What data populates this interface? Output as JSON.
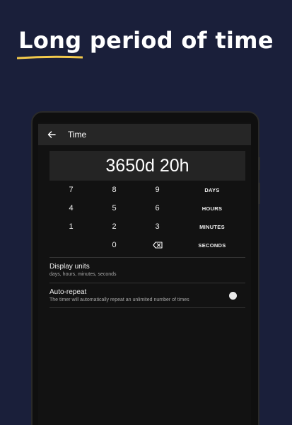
{
  "headline": {
    "word1": "Long",
    "rest": " period of time"
  },
  "app": {
    "title": "Time",
    "display_value": "3650d 20h"
  },
  "keypad": {
    "rows": [
      [
        "7",
        "8",
        "9",
        "DAYS"
      ],
      [
        "4",
        "5",
        "6",
        "HOURS"
      ],
      [
        "1",
        "2",
        "3",
        "MINUTES"
      ],
      [
        "",
        "0",
        "backspace-icon",
        "SECONDS"
      ]
    ]
  },
  "settings": {
    "display_units": {
      "title": "Display units",
      "subtitle": "days, hours, minutes, seconds"
    },
    "auto_repeat": {
      "title": "Auto-repeat",
      "subtitle": "The timer will automatically repeat an unlimited number of times",
      "enabled": false
    }
  },
  "colors": {
    "background": "#1a1f3a",
    "underline": "#f2c94c",
    "screen": "#121212"
  }
}
